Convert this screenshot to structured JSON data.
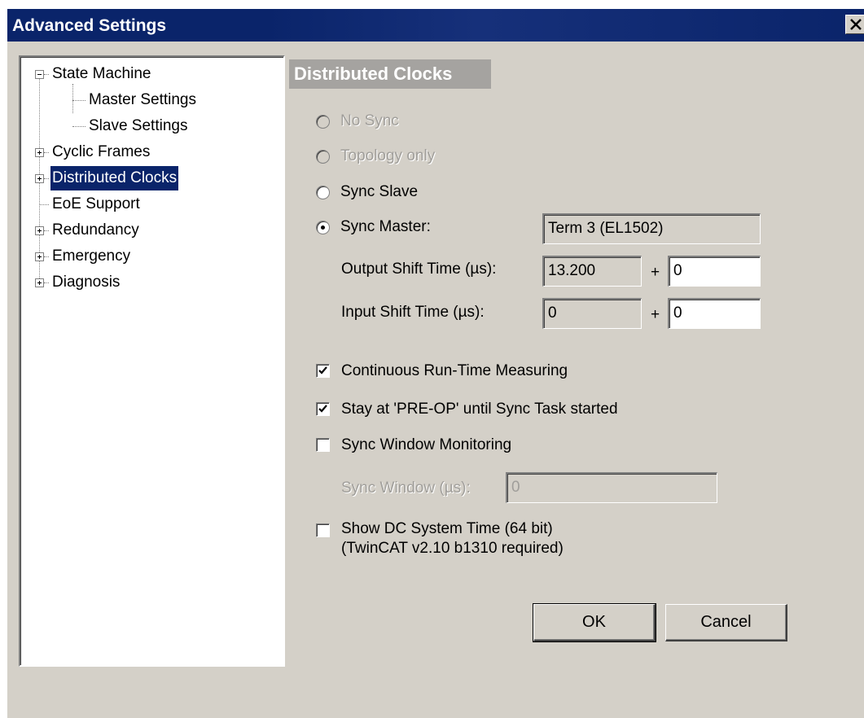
{
  "window": {
    "title": "Advanced Settings"
  },
  "tree": {
    "items": [
      {
        "label": "State Machine",
        "state": "expanded"
      },
      {
        "label": "Master Settings",
        "state": "leaf"
      },
      {
        "label": "Slave Settings",
        "state": "leaf"
      },
      {
        "label": "Cyclic Frames",
        "state": "collapsed"
      },
      {
        "label": "Distributed Clocks",
        "state": "collapsed",
        "selected": true
      },
      {
        "label": "EoE Support",
        "state": "leaf"
      },
      {
        "label": "Redundancy",
        "state": "collapsed"
      },
      {
        "label": "Emergency",
        "state": "collapsed"
      },
      {
        "label": "Diagnosis",
        "state": "collapsed"
      }
    ]
  },
  "panel": {
    "header": "Distributed Clocks",
    "radios": {
      "no_sync": "No Sync",
      "topology_only": "Topology only",
      "sync_slave": "Sync Slave",
      "sync_master": "Sync Master:"
    },
    "sync_master_value": "Term 3 (EL1502)",
    "output_shift": {
      "label": "Output Shift Time (µs):",
      "value": "13.200",
      "plus": "+",
      "offset": "0"
    },
    "input_shift": {
      "label": "Input Shift Time (µs):",
      "value": "0",
      "plus": "+",
      "offset": "0"
    },
    "checkboxes": {
      "continuous": {
        "label": "Continuous Run-Time Measuring",
        "checked": true
      },
      "stay_preop": {
        "label": "Stay at 'PRE-OP' until Sync Task started",
        "checked": true
      },
      "sync_window_monitoring": {
        "label": "Sync Window Monitoring",
        "checked": false
      },
      "show_dc_time": {
        "label_line1": "Show DC System Time (64 bit)",
        "label_line2": "(TwinCAT v2.10 b1310 required)",
        "checked": false
      }
    },
    "sync_window": {
      "label": "Sync Window (µs):",
      "value": "0"
    }
  },
  "buttons": {
    "ok": "OK",
    "cancel": "Cancel"
  },
  "colors": {
    "titlebar": "#0a246a",
    "face": "#d4d0c8",
    "selection": "#0a246a",
    "header_bg": "#a5a3a0",
    "disabled_text": "#a09e9a"
  }
}
